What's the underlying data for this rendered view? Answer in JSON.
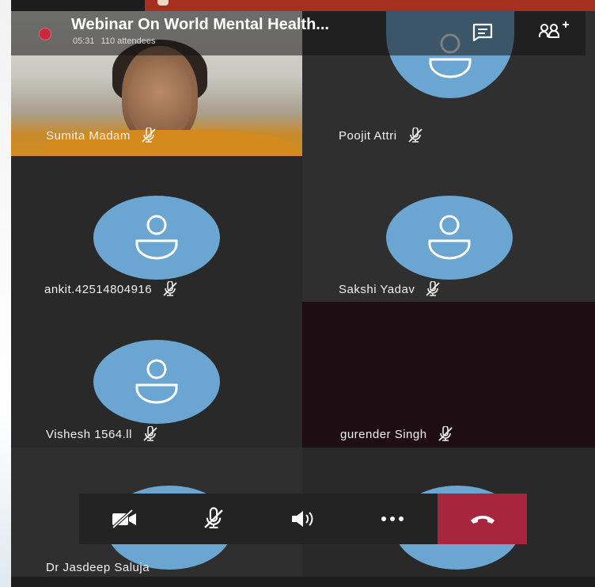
{
  "meeting": {
    "title": "Webinar On World Mental Health...",
    "elapsed": "05:31",
    "attendees": "110 attendees"
  },
  "participants": [
    {
      "name": "Sumita Madam",
      "video": true
    },
    {
      "name": "Poojit Attri"
    },
    {
      "name": "ankit.42514804916"
    },
    {
      "name": "Sakshi Yadav"
    },
    {
      "name": "Vishesh 1564.ll"
    },
    {
      "name": "gurender Singh"
    },
    {
      "name": "Dr Jasdeep Saluja"
    }
  ],
  "icons": {
    "chat": "chat-icon",
    "people": "add-people-icon",
    "muted": "mic-off-icon",
    "camera_off": "camera-off-icon",
    "speaker": "speaker-icon",
    "more": "more-icon",
    "hangup": "hangup-icon"
  },
  "colors": {
    "avatar": "#6aa6d1",
    "recording": "#c72a3a",
    "hangup": "#a8263d",
    "slide_accent": "#a5301f"
  }
}
